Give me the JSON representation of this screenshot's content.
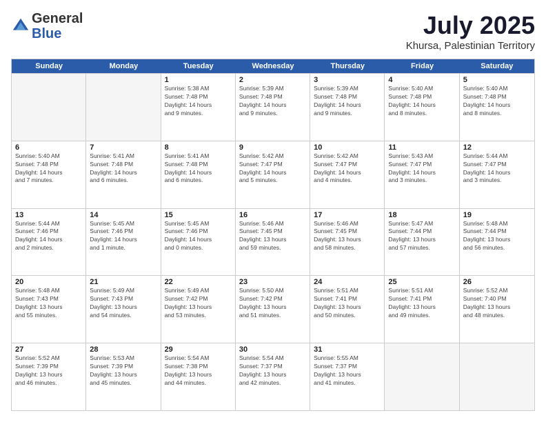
{
  "logo": {
    "general": "General",
    "blue": "Blue"
  },
  "title": "July 2025",
  "location": "Khursa, Palestinian Territory",
  "days_of_week": [
    "Sunday",
    "Monday",
    "Tuesday",
    "Wednesday",
    "Thursday",
    "Friday",
    "Saturday"
  ],
  "weeks": [
    [
      {
        "day": "",
        "empty": true
      },
      {
        "day": "",
        "empty": true
      },
      {
        "day": "1",
        "line1": "Sunrise: 5:38 AM",
        "line2": "Sunset: 7:48 PM",
        "line3": "Daylight: 14 hours",
        "line4": "and 9 minutes."
      },
      {
        "day": "2",
        "line1": "Sunrise: 5:39 AM",
        "line2": "Sunset: 7:48 PM",
        "line3": "Daylight: 14 hours",
        "line4": "and 9 minutes."
      },
      {
        "day": "3",
        "line1": "Sunrise: 5:39 AM",
        "line2": "Sunset: 7:48 PM",
        "line3": "Daylight: 14 hours",
        "line4": "and 9 minutes."
      },
      {
        "day": "4",
        "line1": "Sunrise: 5:40 AM",
        "line2": "Sunset: 7:48 PM",
        "line3": "Daylight: 14 hours",
        "line4": "and 8 minutes."
      },
      {
        "day": "5",
        "line1": "Sunrise: 5:40 AM",
        "line2": "Sunset: 7:48 PM",
        "line3": "Daylight: 14 hours",
        "line4": "and 8 minutes."
      }
    ],
    [
      {
        "day": "6",
        "line1": "Sunrise: 5:40 AM",
        "line2": "Sunset: 7:48 PM",
        "line3": "Daylight: 14 hours",
        "line4": "and 7 minutes."
      },
      {
        "day": "7",
        "line1": "Sunrise: 5:41 AM",
        "line2": "Sunset: 7:48 PM",
        "line3": "Daylight: 14 hours",
        "line4": "and 6 minutes."
      },
      {
        "day": "8",
        "line1": "Sunrise: 5:41 AM",
        "line2": "Sunset: 7:48 PM",
        "line3": "Daylight: 14 hours",
        "line4": "and 6 minutes."
      },
      {
        "day": "9",
        "line1": "Sunrise: 5:42 AM",
        "line2": "Sunset: 7:47 PM",
        "line3": "Daylight: 14 hours",
        "line4": "and 5 minutes."
      },
      {
        "day": "10",
        "line1": "Sunrise: 5:42 AM",
        "line2": "Sunset: 7:47 PM",
        "line3": "Daylight: 14 hours",
        "line4": "and 4 minutes."
      },
      {
        "day": "11",
        "line1": "Sunrise: 5:43 AM",
        "line2": "Sunset: 7:47 PM",
        "line3": "Daylight: 14 hours",
        "line4": "and 3 minutes."
      },
      {
        "day": "12",
        "line1": "Sunrise: 5:44 AM",
        "line2": "Sunset: 7:47 PM",
        "line3": "Daylight: 14 hours",
        "line4": "and 3 minutes."
      }
    ],
    [
      {
        "day": "13",
        "line1": "Sunrise: 5:44 AM",
        "line2": "Sunset: 7:46 PM",
        "line3": "Daylight: 14 hours",
        "line4": "and 2 minutes."
      },
      {
        "day": "14",
        "line1": "Sunrise: 5:45 AM",
        "line2": "Sunset: 7:46 PM",
        "line3": "Daylight: 14 hours",
        "line4": "and 1 minute."
      },
      {
        "day": "15",
        "line1": "Sunrise: 5:45 AM",
        "line2": "Sunset: 7:46 PM",
        "line3": "Daylight: 14 hours",
        "line4": "and 0 minutes."
      },
      {
        "day": "16",
        "line1": "Sunrise: 5:46 AM",
        "line2": "Sunset: 7:45 PM",
        "line3": "Daylight: 13 hours",
        "line4": "and 59 minutes."
      },
      {
        "day": "17",
        "line1": "Sunrise: 5:46 AM",
        "line2": "Sunset: 7:45 PM",
        "line3": "Daylight: 13 hours",
        "line4": "and 58 minutes."
      },
      {
        "day": "18",
        "line1": "Sunrise: 5:47 AM",
        "line2": "Sunset: 7:44 PM",
        "line3": "Daylight: 13 hours",
        "line4": "and 57 minutes."
      },
      {
        "day": "19",
        "line1": "Sunrise: 5:48 AM",
        "line2": "Sunset: 7:44 PM",
        "line3": "Daylight: 13 hours",
        "line4": "and 56 minutes."
      }
    ],
    [
      {
        "day": "20",
        "line1": "Sunrise: 5:48 AM",
        "line2": "Sunset: 7:43 PM",
        "line3": "Daylight: 13 hours",
        "line4": "and 55 minutes."
      },
      {
        "day": "21",
        "line1": "Sunrise: 5:49 AM",
        "line2": "Sunset: 7:43 PM",
        "line3": "Daylight: 13 hours",
        "line4": "and 54 minutes."
      },
      {
        "day": "22",
        "line1": "Sunrise: 5:49 AM",
        "line2": "Sunset: 7:42 PM",
        "line3": "Daylight: 13 hours",
        "line4": "and 53 minutes."
      },
      {
        "day": "23",
        "line1": "Sunrise: 5:50 AM",
        "line2": "Sunset: 7:42 PM",
        "line3": "Daylight: 13 hours",
        "line4": "and 51 minutes."
      },
      {
        "day": "24",
        "line1": "Sunrise: 5:51 AM",
        "line2": "Sunset: 7:41 PM",
        "line3": "Daylight: 13 hours",
        "line4": "and 50 minutes."
      },
      {
        "day": "25",
        "line1": "Sunrise: 5:51 AM",
        "line2": "Sunset: 7:41 PM",
        "line3": "Daylight: 13 hours",
        "line4": "and 49 minutes."
      },
      {
        "day": "26",
        "line1": "Sunrise: 5:52 AM",
        "line2": "Sunset: 7:40 PM",
        "line3": "Daylight: 13 hours",
        "line4": "and 48 minutes."
      }
    ],
    [
      {
        "day": "27",
        "line1": "Sunrise: 5:52 AM",
        "line2": "Sunset: 7:39 PM",
        "line3": "Daylight: 13 hours",
        "line4": "and 46 minutes."
      },
      {
        "day": "28",
        "line1": "Sunrise: 5:53 AM",
        "line2": "Sunset: 7:39 PM",
        "line3": "Daylight: 13 hours",
        "line4": "and 45 minutes."
      },
      {
        "day": "29",
        "line1": "Sunrise: 5:54 AM",
        "line2": "Sunset: 7:38 PM",
        "line3": "Daylight: 13 hours",
        "line4": "and 44 minutes."
      },
      {
        "day": "30",
        "line1": "Sunrise: 5:54 AM",
        "line2": "Sunset: 7:37 PM",
        "line3": "Daylight: 13 hours",
        "line4": "and 42 minutes."
      },
      {
        "day": "31",
        "line1": "Sunrise: 5:55 AM",
        "line2": "Sunset: 7:37 PM",
        "line3": "Daylight: 13 hours",
        "line4": "and 41 minutes."
      },
      {
        "day": "",
        "empty": true
      },
      {
        "day": "",
        "empty": true
      }
    ]
  ]
}
